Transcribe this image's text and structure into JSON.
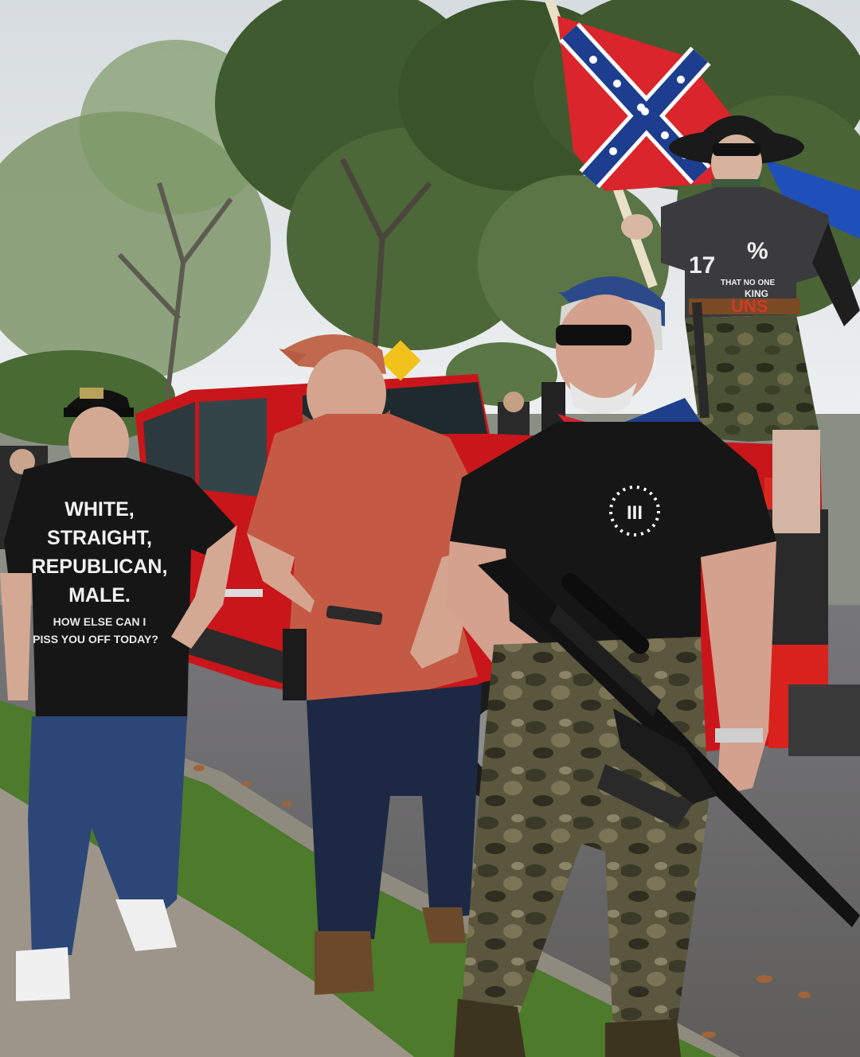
{
  "photo": {
    "shirt_left": {
      "line1": "WHITE,",
      "line2": "STRAIGHT,",
      "line3": "REPUBLICAN,",
      "line4": "MALE.",
      "line5": "HOW ELSE CAN I",
      "line6": "PISS YOU OFF TODAY?"
    },
    "shirt_right": {
      "emblem": "III"
    },
    "shirt_top": {
      "big": "17",
      "partial": "%",
      "line_a": "THAT NO ONE",
      "line_b": "KING",
      "red_word": "UNS"
    },
    "colors": {
      "sky": "#dfe3e6",
      "foliage": "#4f6a3a",
      "truck_red": "#c8161a",
      "asphalt": "#6d6c69",
      "grass": "#4c7a2c",
      "sidewalk": "#9c9488",
      "flag_red": "#d9252b",
      "flag_blue": "#1d3e8f",
      "black_shirt": "#161616",
      "orange_shirt": "#c55a44",
      "camo": "#5d5a40",
      "jeans": "#2c4777"
    }
  }
}
